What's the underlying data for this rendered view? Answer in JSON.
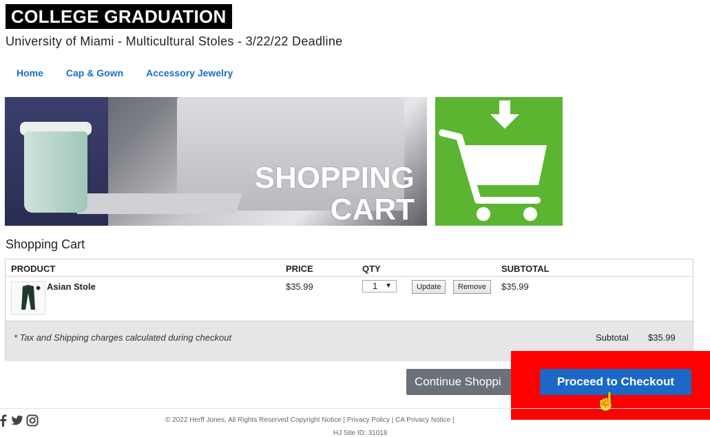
{
  "brand": "COLLEGE GRADUATION",
  "subtitle": "University of Miami - Multicultural Stoles - 3/22/22 Deadline",
  "nav": [
    {
      "label": "Home"
    },
    {
      "label": "Cap & Gown"
    },
    {
      "label": "Accessory Jewelry"
    }
  ],
  "hero": {
    "line1": "SHOPPING",
    "line2": "CART"
  },
  "colors": {
    "accent": "#1b68c6",
    "cart_tile": "#5cb531",
    "highlight": "#ff0000"
  },
  "cart": {
    "title": "Shopping Cart",
    "headers": {
      "product": "PRODUCT",
      "price": "PRICE",
      "qty": "QTY",
      "subtotal": "SUBTOTAL"
    },
    "items": [
      {
        "name": "Asian Stole",
        "price": "$35.99",
        "qty": "1",
        "subtotal": "$35.99"
      }
    ],
    "update_label": "Update",
    "remove_label": "Remove",
    "tax_note": "* Tax and Shipping charges calculated during checkout",
    "subtotal_label": "Subtotal",
    "subtotal_value": "$35.99"
  },
  "actions": {
    "continue_label": "Continue Shoppi",
    "checkout_label": "Proceed to Checkout"
  },
  "footer": {
    "copyright": "© 2022 Herff Jones, All Rights Reserved Copyright Notice | Privacy Policy | CA Privacy Notice |",
    "site_id": "HJ Site ID: 31018",
    "social_icons": [
      "facebook-icon",
      "twitter-icon",
      "instagram-icon"
    ]
  }
}
